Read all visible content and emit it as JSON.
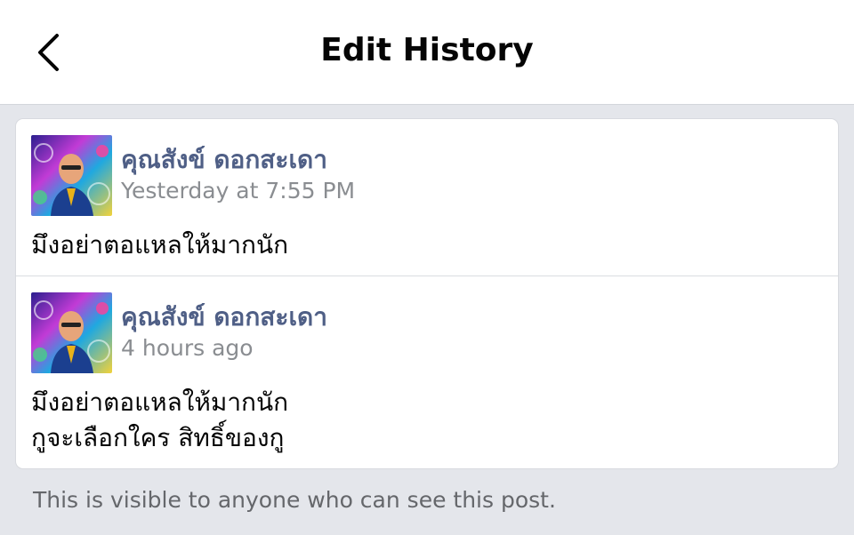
{
  "header": {
    "title": "Edit History",
    "back_icon": "chevron-left-icon"
  },
  "entries": [
    {
      "name": "คุณสังข์ ดอกสะเดา",
      "time": "Yesterday at 7:55 PM",
      "lines": [
        "มึงอย่าตอแหลให้มากนัก"
      ]
    },
    {
      "name": "คุณสังข์ ดอกสะเดา",
      "time": "4 hours ago",
      "lines": [
        "มึงอย่าตอแหลให้มากนัก",
        "กูจะเลือกใคร สิทธิ์ของกู"
      ]
    }
  ],
  "footer": {
    "note": "This is visible to anyone who can see this post."
  },
  "colors": {
    "name": "#4f5f86",
    "muted": "#8a8d91",
    "background": "#e4e6eb"
  }
}
